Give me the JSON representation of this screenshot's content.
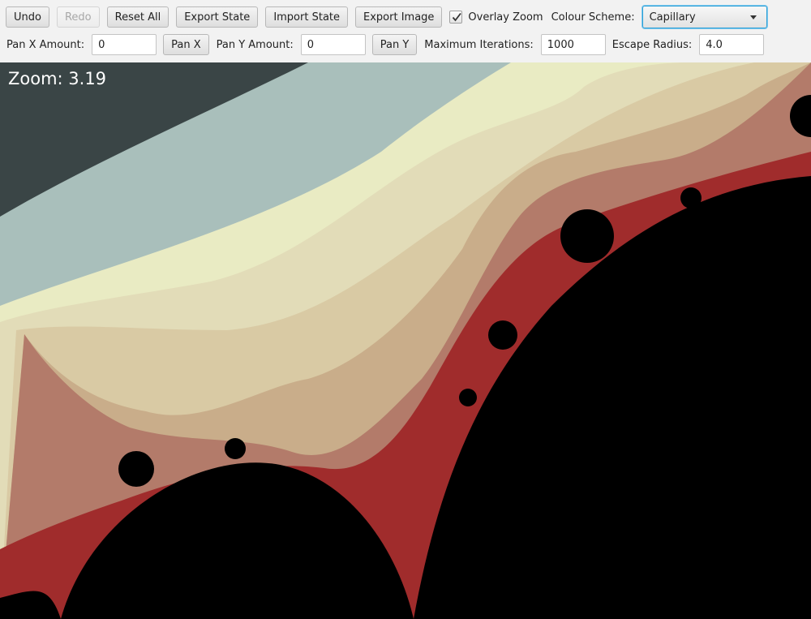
{
  "toolbar": {
    "undo_label": "Undo",
    "redo_label": "Redo",
    "reset_label": "Reset All",
    "export_state_label": "Export State",
    "import_state_label": "Import State",
    "export_image_label": "Export Image",
    "overlay_zoom_label": "Overlay Zoom",
    "overlay_zoom_checked": true,
    "colour_scheme_label": "Colour Scheme:",
    "colour_scheme_value": "Capillary",
    "pan_x_label": "Pan X Amount:",
    "pan_x_value": "0",
    "pan_x_button": "Pan X",
    "pan_y_label": "Pan Y Amount:",
    "pan_y_value": "0",
    "pan_y_button": "Pan Y",
    "max_iter_label": "Maximum Iterations:",
    "max_iter_value": "1000",
    "escape_radius_label": "Escape Radius:",
    "escape_radius_value": "4.0"
  },
  "canvas": {
    "zoom_text": "Zoom: 3.19",
    "colors": {
      "background_dark": "#3a4546",
      "band_blue": "#a9bfbb",
      "band_light": "#e9ebc3",
      "band_tan": "#d9caa4",
      "edge_red": "#a02c2c",
      "set_black": "#000000"
    }
  }
}
